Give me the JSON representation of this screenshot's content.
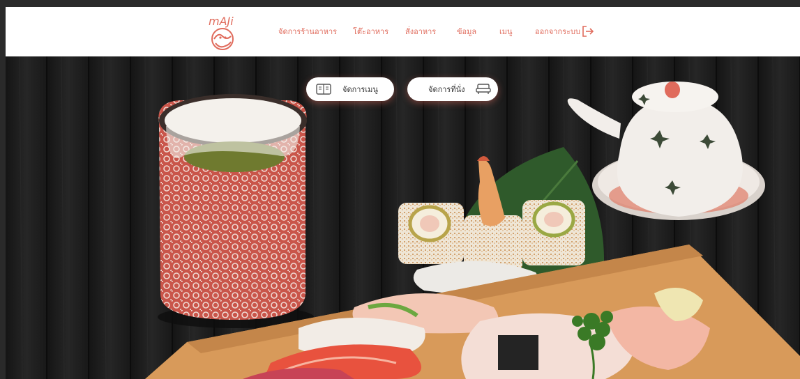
{
  "brand": {
    "logo_text": "mAJi"
  },
  "nav": {
    "items": [
      {
        "label": "จัดการร้านอาหาร"
      },
      {
        "label": "โต๊ะอาหาร"
      },
      {
        "label": "สั่งอาหาร"
      },
      {
        "label": "ข้อมูล"
      },
      {
        "label": "เมนู"
      },
      {
        "label": "ออกจากระบบ"
      }
    ],
    "logout_icon": "logout-arrow-icon"
  },
  "actions": {
    "manage_menu_label": "จัดการเมนู",
    "manage_menu_icon": "menu-book-icon",
    "manage_seat_label": "จัดการที่นั่ง",
    "manage_seat_icon": "sofa-icon"
  },
  "colors": {
    "accent": "#e06b5c",
    "navbar_bg": "#ffffff",
    "hero_bg": "#1c1c1c"
  }
}
